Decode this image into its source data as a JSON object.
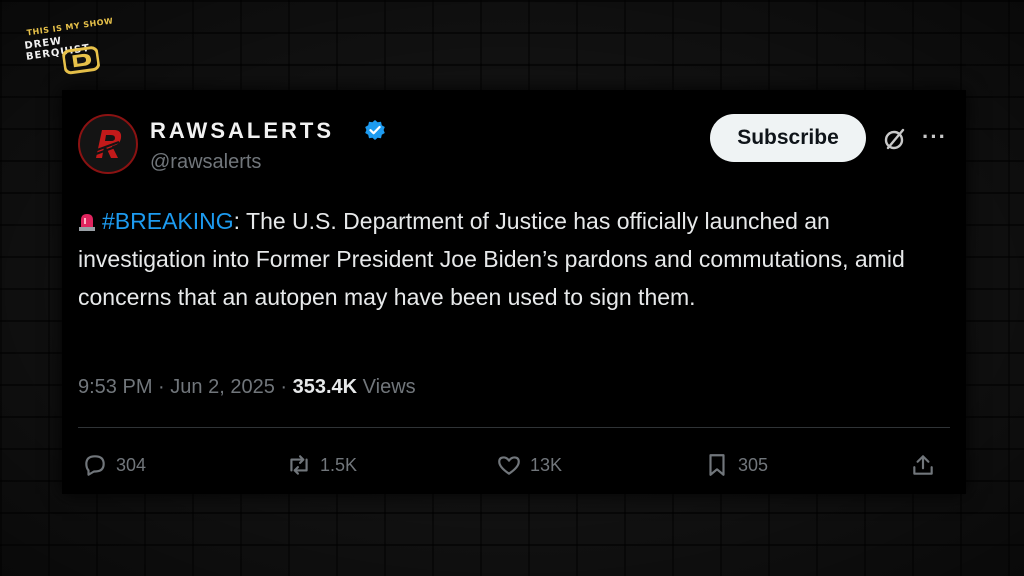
{
  "logo": {
    "top_text": "THIS IS MY SHOW",
    "name_text": "DREW BERQUIST",
    "monogram": "D"
  },
  "tweet": {
    "display_name": "RAWSALERTS",
    "handle": "@rawsalerts",
    "subscribe_label": "Subscribe",
    "more_label": "···",
    "hashtag": "#BREAKING",
    "text": ": The U.S. Department of Justice has officially launched an investigation into Former President Joe Biden’s pardons and commutations, amid concerns that an autopen may have been used to sign them.",
    "time": "9:53 PM",
    "date": "Jun 2, 2025",
    "views_count": "353.4K",
    "views_label": "Views",
    "separator": "·",
    "replies": "304",
    "reposts": "1.5K",
    "likes": "13K",
    "bookmarks": "305"
  },
  "colors": {
    "accent_blue": "#1d9bf0",
    "text_primary": "#e7e9ea",
    "text_secondary": "#71767b",
    "brand_red": "#c21a1a",
    "logo_gold": "#e8c24a"
  },
  "icons": [
    "siren-icon",
    "verified-badge-icon",
    "grok-icon",
    "more-icon",
    "reply-icon",
    "repost-icon",
    "like-icon",
    "bookmark-icon",
    "share-icon"
  ]
}
